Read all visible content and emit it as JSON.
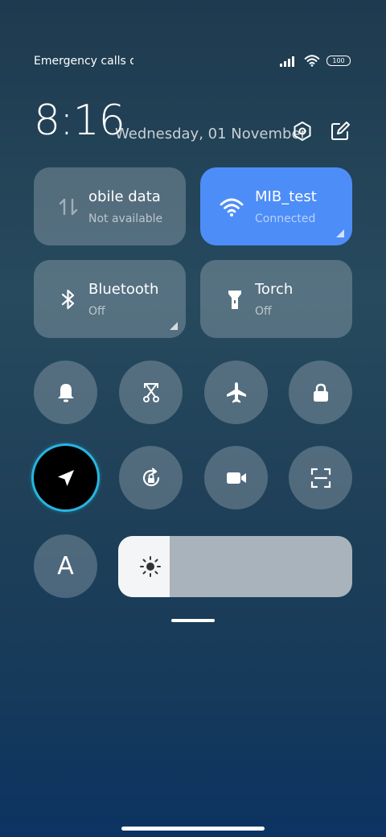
{
  "status_bar": {
    "carrier_text": "Emergency calls o",
    "battery": "100"
  },
  "header": {
    "time": "8:16",
    "date": "Wednesday, 01 November"
  },
  "tiles": {
    "mobile_data": {
      "label": "obile data",
      "sub": "Not available"
    },
    "wifi": {
      "label": "MIB_test",
      "sub": "Connected"
    },
    "bluetooth": {
      "label": "Bluetooth",
      "sub": "Off"
    },
    "torch": {
      "label": "Torch",
      "sub": "Off"
    }
  },
  "toggles": {
    "font_letter": "A"
  },
  "brightness": {
    "level": 0.22
  },
  "colors": {
    "accent": "#4d8df7",
    "active_ring": "#27b5e0"
  }
}
